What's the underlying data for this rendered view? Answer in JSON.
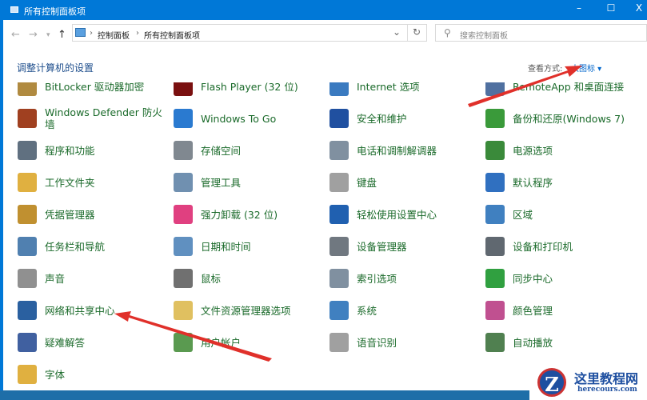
{
  "window": {
    "title": "所有控制面板项",
    "minimize": "–",
    "maximize": "☐",
    "close": "X"
  },
  "nav": {
    "back": "←",
    "forward": "→",
    "recent": "▾",
    "up": "↑",
    "refresh": "↻",
    "dropdown": "⌄"
  },
  "address": {
    "crumbs": [
      "控制面板",
      "所有控制面板项"
    ],
    "sep": "›"
  },
  "search": {
    "placeholder": "搜索控制面板",
    "icon": "⚲"
  },
  "header": {
    "title": "调整计算机的设置",
    "view_by_label": "查看方式:",
    "view_by_value": "大图标 ▾"
  },
  "items": [
    {
      "label": "BitLocker 驱动器加密",
      "color": "#b08a40"
    },
    {
      "label": "Flash Player (32 位)",
      "color": "#7a1010"
    },
    {
      "label": "Internet 选项",
      "color": "#3a7ac0"
    },
    {
      "label": "RemoteApp 和桌面连接",
      "color": "#5070a0"
    },
    {
      "label": "Windows Defender 防火墙",
      "color": "#a04020"
    },
    {
      "label": "Windows To Go",
      "color": "#2a7ad0"
    },
    {
      "label": "安全和维护",
      "color": "#2050a0"
    },
    {
      "label": "备份和还原(Windows 7)",
      "color": "#3a9a3a"
    },
    {
      "label": "程序和功能",
      "color": "#607080"
    },
    {
      "label": "存储空间",
      "color": "#808890"
    },
    {
      "label": "电话和调制解调器",
      "color": "#8090a0"
    },
    {
      "label": "电源选项",
      "color": "#3a8a3a"
    },
    {
      "label": "工作文件夹",
      "color": "#e0b040"
    },
    {
      "label": "管理工具",
      "color": "#7090b0"
    },
    {
      "label": "键盘",
      "color": "#a0a0a0"
    },
    {
      "label": "默认程序",
      "color": "#3070c0"
    },
    {
      "label": "凭据管理器",
      "color": "#c09030"
    },
    {
      "label": "强力卸载 (32 位)",
      "color": "#e04080"
    },
    {
      "label": "轻松使用设置中心",
      "color": "#2060b0"
    },
    {
      "label": "区域",
      "color": "#4080c0"
    },
    {
      "label": "任务栏和导航",
      "color": "#5080b0"
    },
    {
      "label": "日期和时间",
      "color": "#6090c0"
    },
    {
      "label": "设备管理器",
      "color": "#707880"
    },
    {
      "label": "设备和打印机",
      "color": "#606870"
    },
    {
      "label": "声音",
      "color": "#909090"
    },
    {
      "label": "鼠标",
      "color": "#707070"
    },
    {
      "label": "索引选项",
      "color": "#8090a0"
    },
    {
      "label": "同步中心",
      "color": "#30a040"
    },
    {
      "label": "网络和共享中心",
      "color": "#2a60a0"
    },
    {
      "label": "文件资源管理器选项",
      "color": "#e0c060"
    },
    {
      "label": "系统",
      "color": "#4080c0"
    },
    {
      "label": "颜色管理",
      "color": "#c05090"
    },
    {
      "label": "疑难解答",
      "color": "#4060a0"
    },
    {
      "label": "用户帐户",
      "color": "#5a9a50"
    },
    {
      "label": "语音识别",
      "color": "#a0a0a0"
    },
    {
      "label": "自动播放",
      "color": "#508050"
    },
    {
      "label": "字体",
      "color": "#e0b040"
    }
  ],
  "watermark": {
    "name": "这里教程网",
    "url": "herecours.com",
    "letter": "Z"
  },
  "colors": {
    "accent": "#0078d7",
    "arrow": "#e0302a"
  }
}
